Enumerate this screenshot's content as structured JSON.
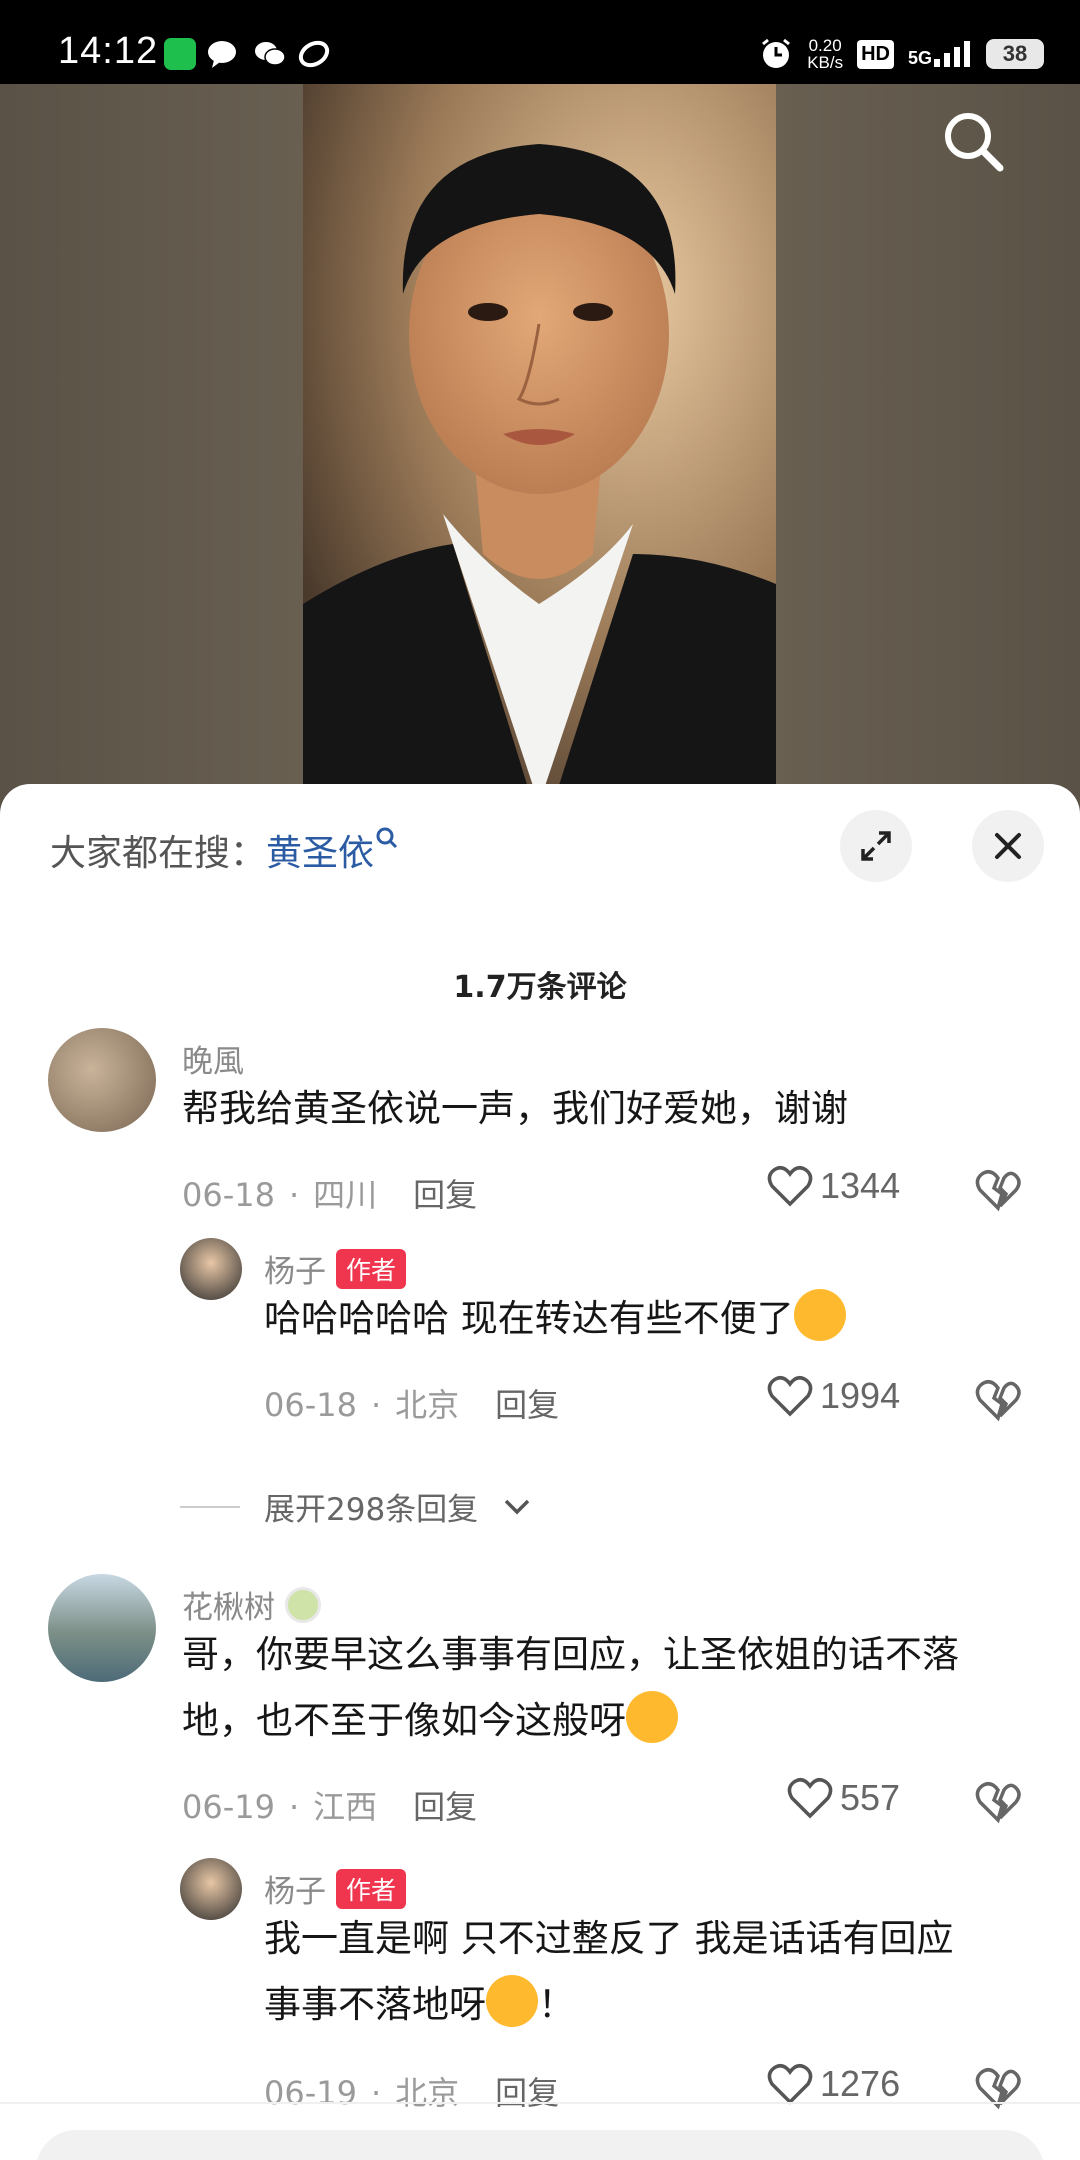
{
  "status_bar": {
    "time": "14:12",
    "speed_value": "0.20",
    "speed_unit": "KB/s",
    "hd": "HD",
    "network": "5G",
    "battery": "38"
  },
  "sheet": {
    "hot_label": "大家都在搜：",
    "hot_term": "黄圣依",
    "comment_count": "1.7万条评论",
    "expand_label": "展开298条回复"
  },
  "comments": [
    {
      "user": "晚風",
      "text": "帮我给黄圣依说一声，我们好爱她，谢谢",
      "date": "06-18",
      "location": "四川",
      "reply": "回复",
      "likes": "1344"
    },
    {
      "user": "杨子",
      "badge": "作者",
      "text": "哈哈哈哈哈 现在转达有些不便了",
      "date": "06-18",
      "location": "北京",
      "reply": "回复",
      "likes": "1994"
    },
    {
      "user": "花楸树",
      "text_line1": "哥，你要早这么事事有回应，让圣依姐的话不落",
      "text_line2": "地，也不至于像如今这般呀",
      "date": "06-19",
      "location": "江西",
      "reply": "回复",
      "likes": "557"
    },
    {
      "user": "杨子",
      "badge": "作者",
      "text_line1": "我一直是啊 只不过整反了 我是话话有回应",
      "text_line2": "事事不落地呀",
      "text_line2_suffix": "！",
      "date": "06-19",
      "location": "北京",
      "reply": "回复",
      "likes": "1276"
    }
  ],
  "colors": {
    "author_badge": "#f0364f",
    "hot_term": "#2a5ba3"
  }
}
